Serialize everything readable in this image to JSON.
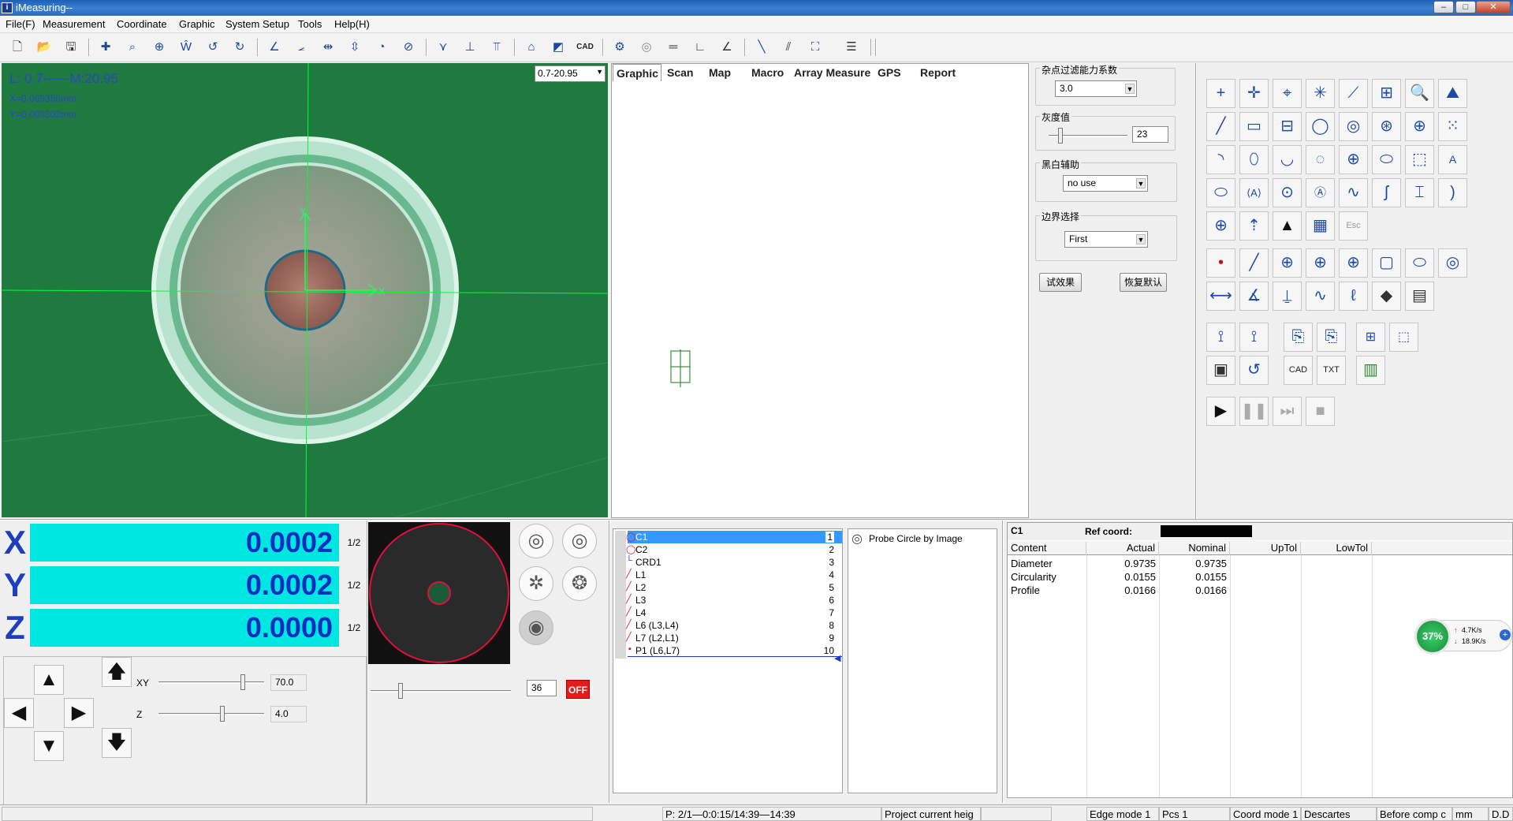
{
  "window": {
    "title": "iMeasuring--",
    "min": "–",
    "max": "□",
    "close": "✕"
  },
  "menu": [
    "File(F)",
    "Measurement",
    "Coordinate",
    "Graphic",
    "System Setup",
    "Tools",
    "Help(H)"
  ],
  "camera": {
    "line1": "L: 0.7------M:20.95",
    "line2": "X=0.009356mm",
    "line3": "Y=0.009302mm",
    "zoom_value": "0.7-20.95",
    "axis_y_label": "Y",
    "axis_x_label": "X"
  },
  "graphic_tabs": [
    "Graphic",
    "Scan",
    "Map",
    "Macro",
    "Array Measure",
    "GPS",
    "Report"
  ],
  "filter": {
    "noise_label": "杂点过滤能力系数",
    "noise_value": "3.0",
    "gray_label": "灰度值",
    "gray_value": "23",
    "bw_label": "黑白辅助",
    "bw_value": "no use",
    "edge_label": "边界选择",
    "edge_value": "First",
    "test_btn": "试效果",
    "default_btn": "恢复默认"
  },
  "dro": {
    "x_label": "X",
    "x_value": "0.0002",
    "y_label": "Y",
    "y_value": "0.0002",
    "z_label": "Z",
    "z_value": "0.0000",
    "half": "1/2"
  },
  "jog": {
    "xy_label": "XY",
    "xy_value": "70.0",
    "z_label": "Z",
    "z_value": "4.0"
  },
  "light": {
    "value": "36",
    "off_label": "OFF"
  },
  "features": [
    {
      "name": "C1",
      "no": "1"
    },
    {
      "name": "C2",
      "no": "2"
    },
    {
      "name": "CRD1",
      "no": "3"
    },
    {
      "name": "L1",
      "no": "4"
    },
    {
      "name": "L2",
      "no": "5"
    },
    {
      "name": "L3",
      "no": "6"
    },
    {
      "name": "L4",
      "no": "7"
    },
    {
      "name": "L6 (L3,L4)",
      "no": "8"
    },
    {
      "name": "L7 (L2,L1)",
      "no": "9"
    },
    {
      "name": "P1 (L6,L7)",
      "no": "10"
    }
  ],
  "probe": {
    "label": "Probe Circle by Image"
  },
  "results": {
    "feature": "C1",
    "ref_label": "Ref coord:",
    "headers": [
      "Content",
      "Actual",
      "Nominal",
      "UpTol",
      "LowTol"
    ],
    "rows": [
      {
        "content": "Diameter",
        "actual": "0.9735",
        "nominal": "0.9735"
      },
      {
        "content": "Circularity",
        "actual": "0.0155",
        "nominal": "0.0155"
      },
      {
        "content": "Profile",
        "actual": "0.0166",
        "nominal": "0.0166"
      }
    ]
  },
  "netwidget": {
    "percent": "37%",
    "up": "4.7K/s",
    "down": "18.9K/s"
  },
  "status": {
    "time": "P: 2/1—0:0:15/14:39—14:39",
    "project": "Project current heig",
    "edge": "Edge mode 1",
    "pcs": "Pcs 1",
    "coord": "Coord mode 1",
    "descartes": "Descartes",
    "comp": "Before comp c",
    "unit": "mm",
    "dd": "D.D"
  },
  "colors": {
    "camera_bg": "#1f7a3f",
    "dro_bg": "#00e6e1",
    "dro_text": "#0a2fc0",
    "accent": "#1d49a8"
  }
}
